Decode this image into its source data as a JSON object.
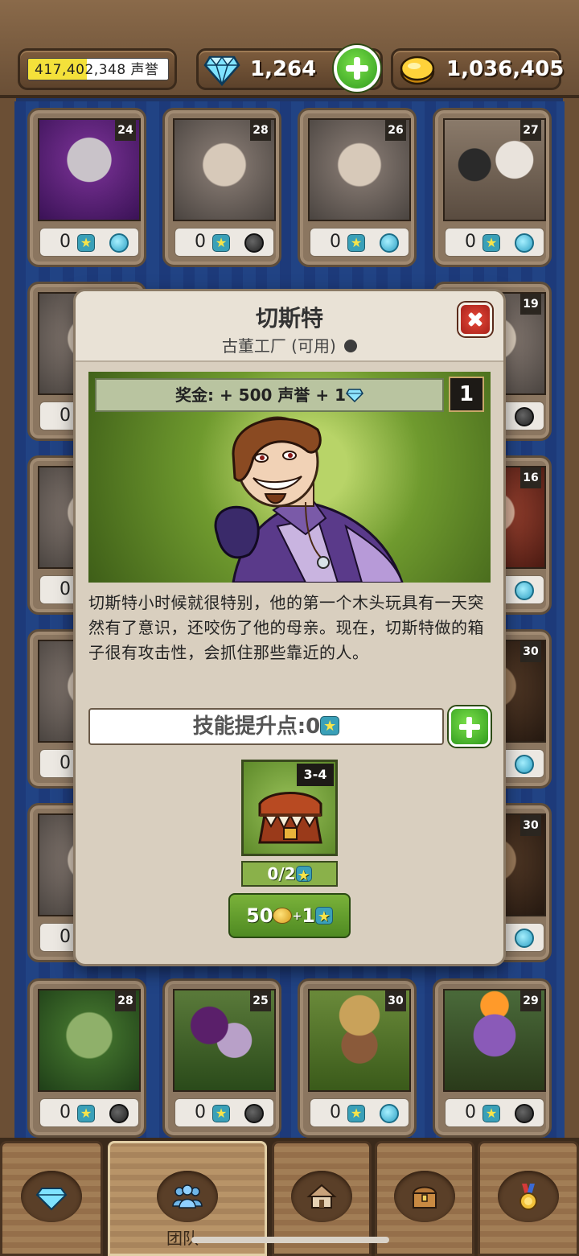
{
  "header": {
    "fame": {
      "value_text": "417,402,348 声誉",
      "fill_fraction": 0.42
    },
    "gems": "1,264",
    "gold": "1,036,405",
    "colors": {
      "gem": "#4fd3ff",
      "gold": "#f2b91c",
      "plus": "#3ea81f"
    }
  },
  "cards": [
    {
      "level": "24",
      "count": "0",
      "active": true,
      "art": "art-purple"
    },
    {
      "level": "28",
      "count": "0",
      "active": false,
      "art": "art-grey"
    },
    {
      "level": "26",
      "count": "0",
      "active": true,
      "art": "art-grey"
    },
    {
      "level": "27",
      "count": "0",
      "active": true,
      "art": "art-cats"
    },
    {
      "level": "19",
      "count": "",
      "active": false,
      "art": "art-grey"
    },
    {
      "level": "16",
      "count": "",
      "active": true,
      "art": "art-red"
    },
    {
      "level": "30",
      "count": "",
      "active": true,
      "art": "art-dark"
    },
    {
      "level": "30",
      "count": "",
      "active": true,
      "art": "art-dark"
    },
    {
      "level": "28",
      "count": "0",
      "active": false,
      "art": "art-green"
    },
    {
      "level": "25",
      "count": "0",
      "active": false,
      "art": "art-plant"
    },
    {
      "level": "30",
      "count": "0",
      "active": true,
      "art": "art-farmer"
    },
    {
      "level": "29",
      "count": "0",
      "active": false,
      "art": "art-demon"
    }
  ],
  "left_partial_counts": [
    "0",
    "0",
    "0",
    "0"
  ],
  "modal": {
    "title": "切斯特",
    "subtitle": "古董工厂 (可用)",
    "bonus": "奖金: + 500 声誉 + 1",
    "owned_count": "1",
    "description": "切斯特小时候就很特别，他的第一个木头玩具有一天突然有了意识，还咬伤了他的母亲。现在，切斯特做的箱子很有攻击性，会抓住那些靠近的人。",
    "skill_points": "技能提升点:0",
    "ability": {
      "level": "3-4",
      "progress": "0/2",
      "cost_gold": "50",
      "cost_stars": "1"
    }
  },
  "nav": {
    "tabs": [
      "gem-shop",
      "team",
      "buildings",
      "treasure",
      "achievements"
    ],
    "active_label": "团队"
  }
}
